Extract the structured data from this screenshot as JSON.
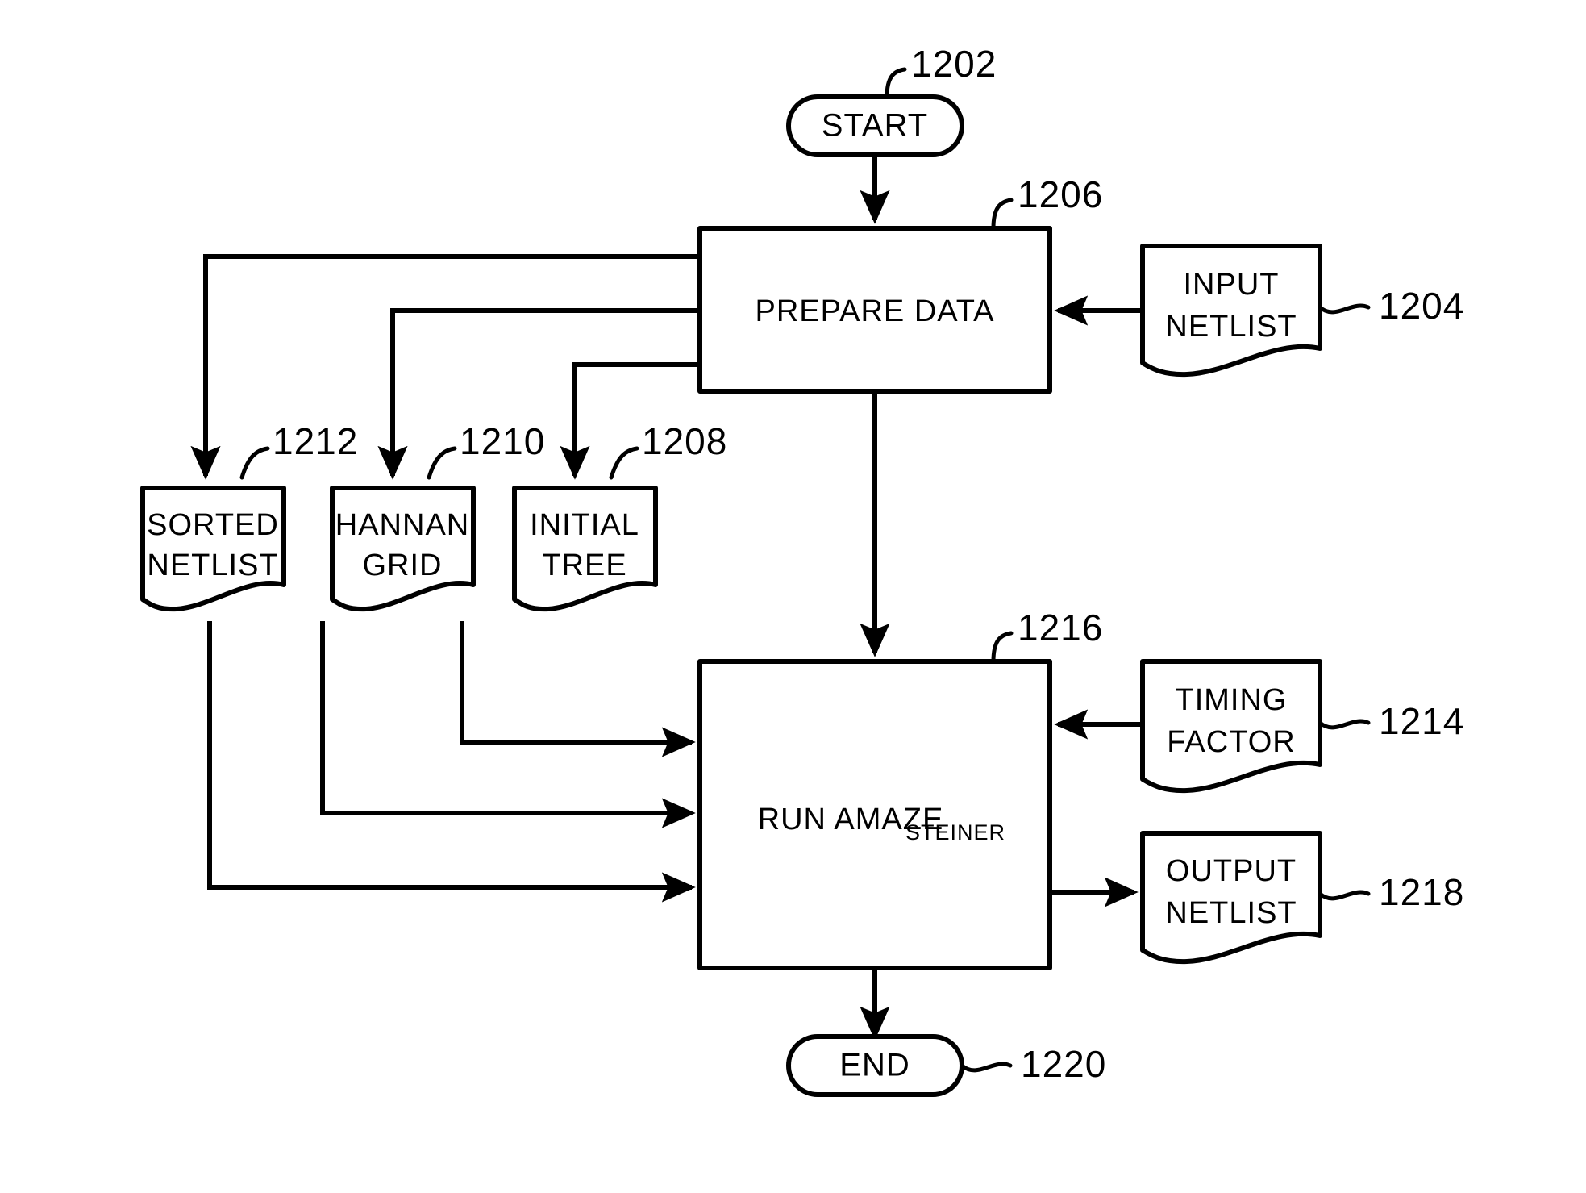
{
  "figure": {
    "type": "patent-flowchart",
    "background_color": "#ffffff",
    "stroke_color": "#000000"
  },
  "nodes": {
    "start": {
      "label": "START",
      "ref": "1202",
      "shape": "stadium"
    },
    "input_netlist": {
      "label_line1": "INPUT",
      "label_line2": "NETLIST",
      "ref": "1204",
      "shape": "document"
    },
    "prepare_data": {
      "label": "PREPARE  DATA",
      "ref": "1206",
      "shape": "process"
    },
    "initial_tree": {
      "label_line1": "INITIAL",
      "label_line2": "TREE",
      "ref": "1208",
      "shape": "document"
    },
    "hannan_grid": {
      "label_line1": "HANNAN",
      "label_line2": "GRID",
      "ref": "1210",
      "shape": "document"
    },
    "sorted_netlist": {
      "label_line1": "SORTED",
      "label_line2": "NETLIST",
      "ref": "1212",
      "shape": "document"
    },
    "timing_factor": {
      "label_line1": "TIMING",
      "label_line2": "FACTOR",
      "ref": "1214",
      "shape": "document"
    },
    "run_amaze": {
      "label": "RUN  AMAZE",
      "label_subscript": "STEINER",
      "ref": "1216",
      "shape": "process"
    },
    "output_netlist": {
      "label_line1": "OUTPUT",
      "label_line2": "NETLIST",
      "ref": "1218",
      "shape": "document"
    },
    "end": {
      "label": "END",
      "ref": "1220",
      "shape": "stadium"
    }
  },
  "edges": [
    {
      "from": "start",
      "to": "prepare_data",
      "arrow": true
    },
    {
      "from": "input_netlist",
      "to": "prepare_data",
      "arrow": true
    },
    {
      "from": "prepare_data",
      "to": "sorted_netlist",
      "arrow": true
    },
    {
      "from": "prepare_data",
      "to": "hannan_grid",
      "arrow": true
    },
    {
      "from": "prepare_data",
      "to": "initial_tree",
      "arrow": true
    },
    {
      "from": "prepare_data",
      "to": "run_amaze",
      "arrow": true
    },
    {
      "from": "initial_tree",
      "to": "run_amaze",
      "arrow": true
    },
    {
      "from": "hannan_grid",
      "to": "run_amaze",
      "arrow": true
    },
    {
      "from": "sorted_netlist",
      "to": "run_amaze",
      "arrow": true
    },
    {
      "from": "timing_factor",
      "to": "run_amaze",
      "arrow": true
    },
    {
      "from": "run_amaze",
      "to": "output_netlist",
      "arrow": true
    },
    {
      "from": "run_amaze",
      "to": "end",
      "arrow": true
    }
  ]
}
